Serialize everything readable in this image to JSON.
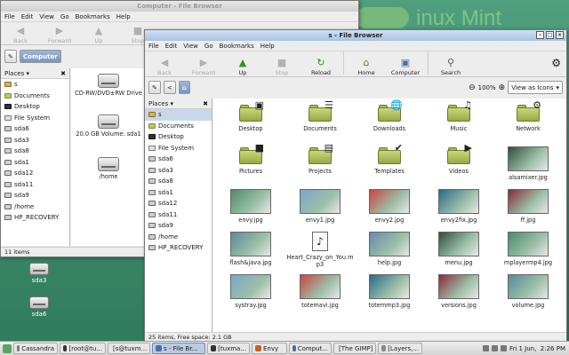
{
  "desktop": {
    "icons": [
      {
        "label": "sda3"
      },
      {
        "label": "sda6"
      }
    ]
  },
  "back_window": {
    "title": "Computer - File Browser",
    "menu": [
      "File",
      "Edit",
      "View",
      "Go",
      "Bookmarks",
      "Help"
    ],
    "toolbar": [
      "Back",
      "Forward",
      "Up",
      "Stop"
    ],
    "location": "Computer",
    "sidebar_title": "Places",
    "places": [
      "s",
      "Documents",
      "Desktop",
      "File System",
      "sda6",
      "sda3",
      "sda8",
      "sda1",
      "sda12",
      "sda11",
      "sda9",
      "/home",
      "HP_RECOVERY"
    ],
    "items": [
      {
        "label": "CD-RW/DVD±RW Drive"
      },
      {
        "label": "20.0 GB Volume: sda1"
      },
      {
        "label": "/home"
      }
    ],
    "status": "11 items"
  },
  "front_window": {
    "title": "s - File Browser",
    "menu": [
      "File",
      "Edit",
      "View",
      "Go",
      "Bookmarks",
      "Help"
    ],
    "toolbar": [
      {
        "label": "Back",
        "enabled": false
      },
      {
        "label": "Forward",
        "enabled": false
      },
      {
        "label": "Up",
        "enabled": true
      },
      {
        "label": "Stop",
        "enabled": false
      },
      {
        "label": "Reload",
        "enabled": true
      },
      {
        "label": "Home",
        "enabled": true
      },
      {
        "label": "Computer",
        "enabled": true
      },
      {
        "label": "Search",
        "enabled": true
      }
    ],
    "zoom": "100%",
    "view_mode": "View as Icons",
    "sidebar_title": "Places",
    "places": [
      "s",
      "Documents",
      "Desktop",
      "File System",
      "sda6",
      "sda3",
      "sda8",
      "sda1",
      "sda12",
      "sda11",
      "sda9",
      "/home",
      "HP_RECOVERY"
    ],
    "selected_place": "s",
    "files": [
      {
        "name": "Desktop",
        "kind": "folder",
        "icon": "desktop-emblem"
      },
      {
        "name": "Documents",
        "kind": "folder",
        "icon": "documents-emblem"
      },
      {
        "name": "Downloads",
        "kind": "folder",
        "icon": "globe-emblem"
      },
      {
        "name": "Music",
        "kind": "folder",
        "icon": "music-emblem"
      },
      {
        "name": "Network",
        "kind": "folder",
        "icon": "network-emblem"
      },
      {
        "name": "Pictures",
        "kind": "folder",
        "icon": "pictures-emblem"
      },
      {
        "name": "Projects",
        "kind": "folder",
        "icon": "projects-emblem"
      },
      {
        "name": "Templates",
        "kind": "folder",
        "icon": "templates-emblem"
      },
      {
        "name": "Videos",
        "kind": "folder",
        "icon": "videos-emblem"
      },
      {
        "name": "alsamixer.jpg",
        "kind": "image"
      },
      {
        "name": "envy.jpg",
        "kind": "image"
      },
      {
        "name": "envy1.jpg",
        "kind": "image"
      },
      {
        "name": "envy2.jpg",
        "kind": "image"
      },
      {
        "name": "envy2fix.jpg",
        "kind": "image"
      },
      {
        "name": "ff.jpg",
        "kind": "image"
      },
      {
        "name": "flash&java.jpg",
        "kind": "image"
      },
      {
        "name": "Heart_Crazy_on_You.mp3",
        "kind": "audio"
      },
      {
        "name": "help.jpg",
        "kind": "image"
      },
      {
        "name": "menu.jpg",
        "kind": "image"
      },
      {
        "name": "mplayermp4.jpg",
        "kind": "image"
      },
      {
        "name": "systray.jpg",
        "kind": "image"
      },
      {
        "name": "totemavi.jpg",
        "kind": "image"
      },
      {
        "name": "totemmp3.jpg",
        "kind": "image"
      },
      {
        "name": "versions.jpg",
        "kind": "image"
      },
      {
        "name": "volume.jpg",
        "kind": "image"
      }
    ],
    "status": "25 items, Free space: 2.1 GB"
  },
  "taskbar": {
    "tasks": [
      {
        "label": "Cassandra",
        "active": false
      },
      {
        "label": "[root@tu...",
        "active": false
      },
      {
        "label": "[s@tuxm...",
        "active": false
      },
      {
        "label": "s - File Br...",
        "active": true
      },
      {
        "label": "[tuxma...",
        "active": false
      },
      {
        "label": "Envy",
        "active": false
      },
      {
        "label": "Comput...",
        "active": false
      },
      {
        "label": "[The GIMP]",
        "active": false
      },
      {
        "label": "[Layers,...",
        "active": false
      }
    ],
    "clock": "Fri 1 Jun,  2:26 PM"
  },
  "colors": {
    "desktop": "#3e8c6c",
    "active_title": "#a9c2e3",
    "selection": "#c8d8ea",
    "folder": "#b9c96a"
  }
}
